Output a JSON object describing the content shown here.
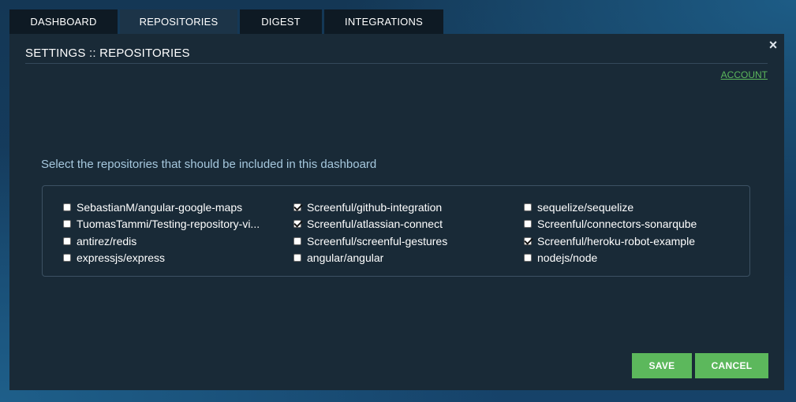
{
  "tabs": [
    {
      "label": "DASHBOARD"
    },
    {
      "label": "REPOSITORIES"
    },
    {
      "label": "DIGEST"
    },
    {
      "label": "INTEGRATIONS"
    }
  ],
  "modal": {
    "title": "SETTINGS :: REPOSITORIES",
    "account_link": "ACCOUNT",
    "prompt": "Select the repositories that should be included in this dashboard",
    "close_icon": "×",
    "save_label": "SAVE",
    "cancel_label": "CANCEL"
  },
  "repositories": [
    [
      {
        "name": "SebastianM/angular-google-maps",
        "checked": false
      },
      {
        "name": "TuomasTammi/Testing-repository-vi...",
        "checked": false
      },
      {
        "name": "antirez/redis",
        "checked": false
      },
      {
        "name": "expressjs/express",
        "checked": false
      }
    ],
    [
      {
        "name": "Screenful/github-integration",
        "checked": true
      },
      {
        "name": "Screenful/atlassian-connect",
        "checked": true
      },
      {
        "name": "Screenful/screenful-gestures",
        "checked": false
      },
      {
        "name": "angular/angular",
        "checked": false
      }
    ],
    [
      {
        "name": "sequelize/sequelize",
        "checked": false
      },
      {
        "name": "Screenful/connectors-sonarqube",
        "checked": false
      },
      {
        "name": "Screenful/heroku-robot-example",
        "checked": true
      },
      {
        "name": "nodejs/node",
        "checked": false
      }
    ]
  ],
  "colors": {
    "accent": "#5cb85c",
    "panel": "#192a37",
    "tab": "#0e1a24",
    "tab_active": "#1c3448"
  }
}
